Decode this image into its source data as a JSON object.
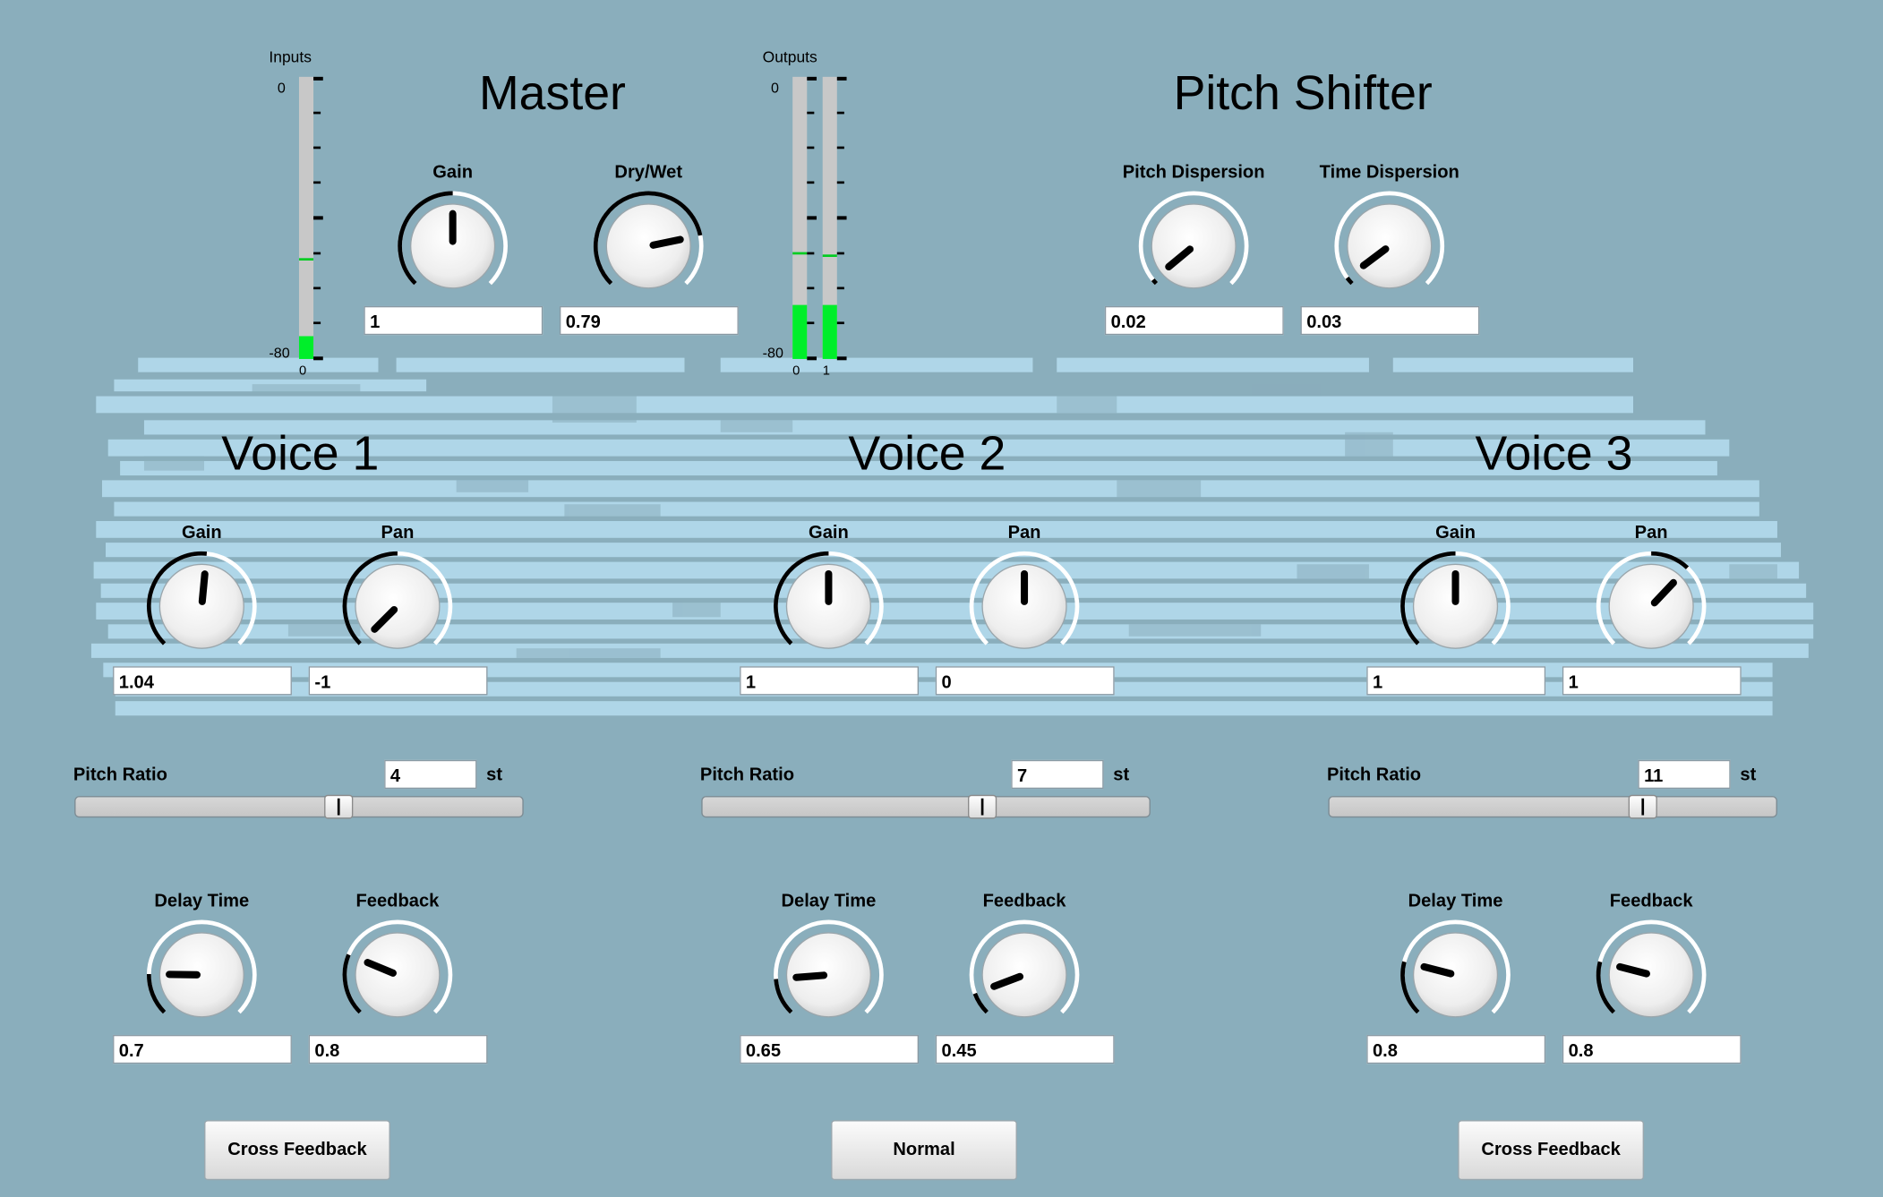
{
  "master": {
    "title": "Master",
    "gain": {
      "label": "Gain",
      "value": "1",
      "level": 0.5
    },
    "drywet": {
      "label": "Dry/Wet",
      "value": "0.79",
      "level": 0.79
    }
  },
  "meters": {
    "inputs_label": "Inputs",
    "outputs_label": "Outputs",
    "scale_top": "0",
    "scale_bottom": "-80",
    "input_channel": "0",
    "output_channels": [
      "0",
      "1"
    ],
    "input_level": 0.08,
    "input_peak": 0.35,
    "output_levels": [
      0.19,
      0.19
    ],
    "output_peaks": [
      0.37,
      0.36
    ]
  },
  "pitch_shifter": {
    "title": "Pitch Shifter",
    "pitch_dispersion": {
      "label": "Pitch Dispersion",
      "value": "0.02",
      "level": 0.02
    },
    "time_dispersion": {
      "label": "Time Dispersion",
      "value": "0.03",
      "level": 0.03
    }
  },
  "voices": [
    {
      "title": "Voice 1",
      "gain": {
        "label": "Gain",
        "value": "1.04",
        "level": 0.52
      },
      "pan": {
        "label": "Pan",
        "value": "-1",
        "level": 0.0,
        "bipolar": true
      },
      "pitch": {
        "label": "Pitch Ratio",
        "value": "4",
        "unit": "st",
        "level": 0.59
      },
      "delay": {
        "label": "Delay Time",
        "value": "0.7",
        "level": 0.17
      },
      "feedback": {
        "label": "Feedback",
        "value": "0.8",
        "level": 0.25
      },
      "mode_button": "Cross Feedback"
    },
    {
      "title": "Voice 2",
      "gain": {
        "label": "Gain",
        "value": "1",
        "level": 0.5
      },
      "pan": {
        "label": "Pan",
        "value": "0",
        "level": 0.5,
        "bipolar": true
      },
      "pitch": {
        "label": "Pitch Ratio",
        "value": "7",
        "unit": "st",
        "level": 0.63
      },
      "delay": {
        "label": "Delay Time",
        "value": "0.65",
        "level": 0.15
      },
      "feedback": {
        "label": "Feedback",
        "value": "0.45",
        "level": 0.09
      },
      "mode_button": "Normal"
    },
    {
      "title": "Voice 3",
      "gain": {
        "label": "Gain",
        "value": "1",
        "level": 0.5
      },
      "pan": {
        "label": "Pan",
        "value": "1",
        "level": 0.66,
        "bipolar": true
      },
      "pitch": {
        "label": "Pitch Ratio",
        "value": "11",
        "unit": "st",
        "level": 0.71
      },
      "delay": {
        "label": "Delay Time",
        "value": "0.8",
        "level": 0.22
      },
      "feedback": {
        "label": "Feedback",
        "value": "0.8",
        "level": 0.22
      },
      "mode_button": "Cross Feedback"
    }
  ],
  "colors": {
    "background": "#8aaebc",
    "texture": "#b4dcec",
    "arc_active": "#000000",
    "arc_inactive": "#ffffff",
    "meter_fill": "#00ee2a"
  }
}
